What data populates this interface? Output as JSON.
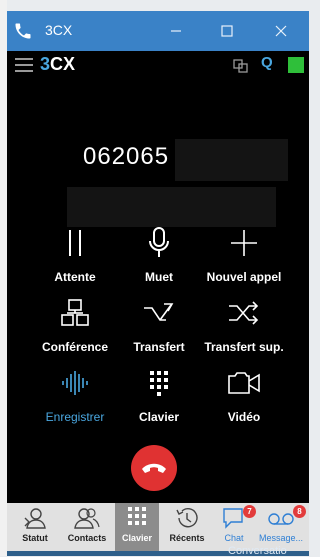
{
  "window": {
    "title": "3CX"
  },
  "appbar": {
    "logo_prefix": "3",
    "logo_suffix": "CX",
    "q_label": "Q",
    "status_color": "#2fbf3a"
  },
  "call": {
    "number": "062065"
  },
  "buttons": [
    {
      "label": "Attente",
      "icon": "pause-icon"
    },
    {
      "label": "Muet",
      "icon": "microphone-icon"
    },
    {
      "label": "Nouvel appel",
      "icon": "plus-icon"
    },
    {
      "label": "Conférence",
      "icon": "conference-icon"
    },
    {
      "label": "Transfert",
      "icon": "transfer-icon"
    },
    {
      "label": "Transfert sup.",
      "icon": "attended-transfer-icon"
    },
    {
      "label": "Enregistrer",
      "icon": "record-waveform-icon"
    },
    {
      "label": "Clavier",
      "icon": "keypad-icon"
    },
    {
      "label": "Vidéo",
      "icon": "video-camera-icon"
    }
  ],
  "nav": [
    {
      "label": "Statut"
    },
    {
      "label": "Contacts"
    },
    {
      "label": "Clavier"
    },
    {
      "label": "Récents"
    },
    {
      "label": "Chat",
      "badge": "7"
    },
    {
      "label": "Message...",
      "badge": "8"
    }
  ],
  "colors": {
    "accent": "#3a82c7",
    "hangup": "#e03232",
    "record": "#4aa7e0"
  },
  "behind": {
    "text": "Conversatio"
  }
}
